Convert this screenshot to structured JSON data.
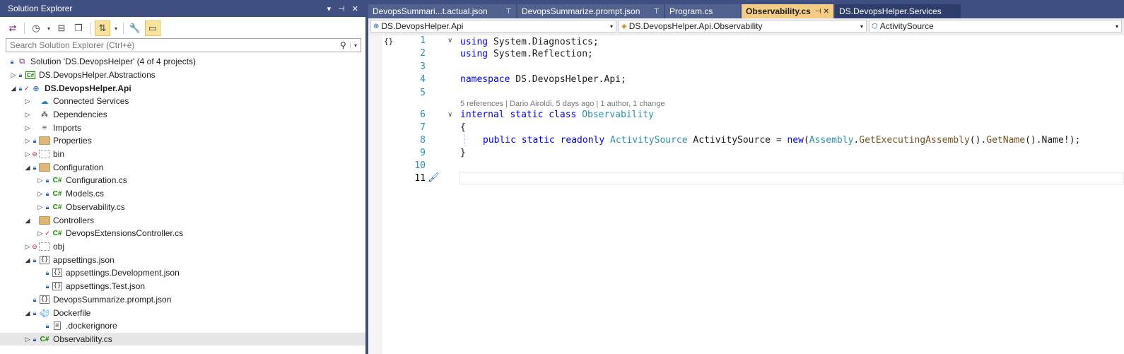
{
  "solution_explorer": {
    "title": "Solution Explorer",
    "title_controls": [
      "▾",
      "⊣",
      "✕"
    ],
    "search_placeholder": "Search Solution Explorer (Ctrl+è)",
    "tree": [
      {
        "label": "Solution 'DS.DevopsHelper' (4 of 4 projects)",
        "icon": "solution-icon"
      },
      {
        "label": "DS.DevopsHelper.Abstractions",
        "icon": "csharp-project-icon"
      },
      {
        "label": "DS.DevopsHelper.Api",
        "icon": "web-project-icon"
      },
      {
        "label": "Connected Services",
        "icon": "connected-services-icon"
      },
      {
        "label": "Dependencies",
        "icon": "dependencies-icon"
      },
      {
        "label": "Imports",
        "icon": "imports-icon"
      },
      {
        "label": "Properties",
        "icon": "properties-icon"
      },
      {
        "label": "bin",
        "icon": "folder-excluded-icon"
      },
      {
        "label": "Configuration",
        "icon": "folder-icon"
      },
      {
        "label": "Configuration.cs",
        "icon": "csharp-file-icon"
      },
      {
        "label": "Models.cs",
        "icon": "csharp-file-icon"
      },
      {
        "label": "Observability.cs",
        "icon": "csharp-file-icon"
      },
      {
        "label": "Controllers",
        "icon": "folder-icon"
      },
      {
        "label": "DevopsExtensionsController.cs",
        "icon": "csharp-file-icon"
      },
      {
        "label": "obj",
        "icon": "folder-excluded-icon"
      },
      {
        "label": "appsettings.json",
        "icon": "json-file-icon"
      },
      {
        "label": "appsettings.Development.json",
        "icon": "json-file-icon"
      },
      {
        "label": "appsettings.Test.json",
        "icon": "json-file-icon"
      },
      {
        "label": "DevopsSummarize.prompt.json",
        "icon": "json-file-icon"
      },
      {
        "label": "Dockerfile",
        "icon": "docker-icon"
      },
      {
        "label": ".dockerignore",
        "icon": "file-icon"
      },
      {
        "label": "Observability.cs",
        "icon": "csharp-file-icon"
      }
    ]
  },
  "tabs": [
    {
      "label": "DevopsSummari...t.actual.json",
      "pin": "⊤"
    },
    {
      "label": "DevopsSummarize.prompt.json",
      "pin": "⊤"
    },
    {
      "label": "Program.cs",
      "pin": ""
    },
    {
      "label": "Observability.cs",
      "pin": "⊣ ✕"
    },
    {
      "label": "DS.DevopsHelper.Services",
      "pin": ""
    }
  ],
  "navbar": {
    "project": "DS.DevopsHelper.Api",
    "type": "DS.DevopsHelper.Api.Observability",
    "member": "ActivitySource"
  },
  "code": {
    "line_numbers": [
      "1",
      "2",
      "3",
      "4",
      "5",
      "6",
      "7",
      "8",
      "9",
      "10",
      "11"
    ],
    "codelens": "5 references | Dario Airoldi, 5 days ago | 1 author, 1 change",
    "lines": {
      "l1_kw": "using",
      "l1_rest": " System.Diagnostics;",
      "l2_kw": "using",
      "l2_rest": " System.Reflection;",
      "l4_kw": "namespace",
      "l4_rest": " DS.DevopsHelper.Api;",
      "l6_kw": "internal static class",
      "l6_ty": " Observability",
      "l7": "{",
      "l8_kw": "public static readonly",
      "l8_ty": " ActivitySource",
      "l8_a": " ActivitySource = ",
      "l8_new": "new",
      "l8_p1": "(",
      "l8_asm": "Assembly",
      "l8_dot1": ".",
      "l8_gea": "GetExecutingAssembly",
      "l8_p2": "().",
      "l8_gn": "GetName",
      "l8_end": "().Name!);",
      "l9": "}"
    }
  }
}
